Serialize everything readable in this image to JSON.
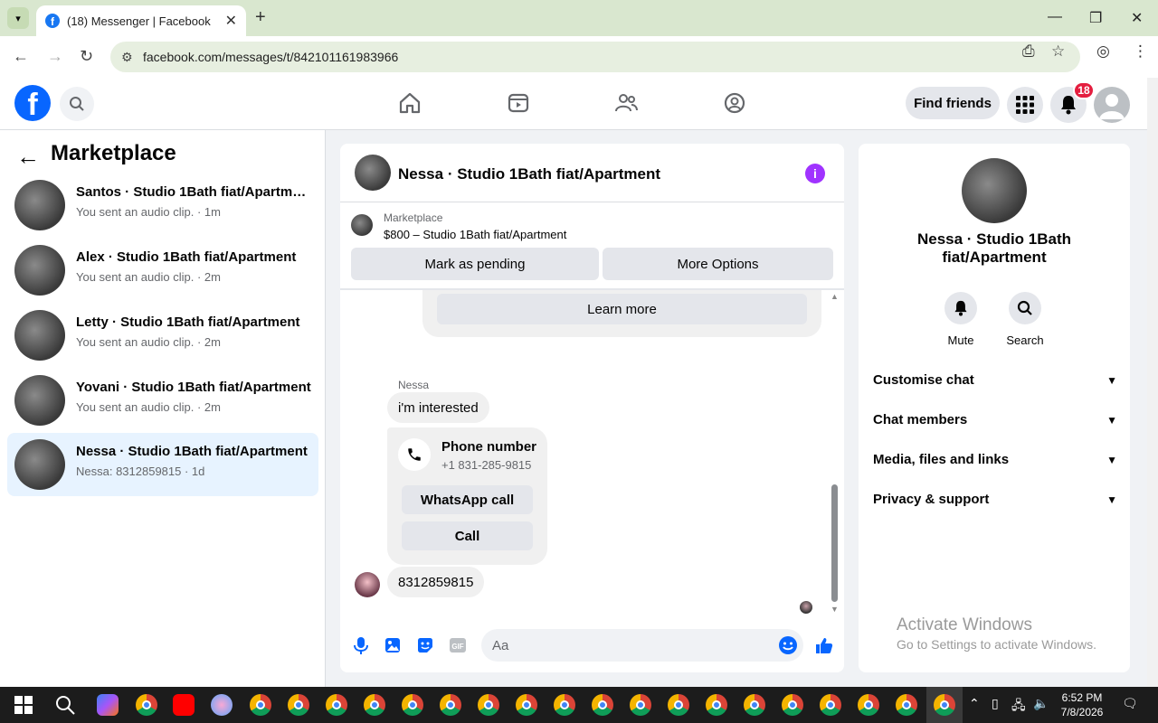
{
  "browser": {
    "tab_title": "(18) Messenger | Facebook",
    "url": "facebook.com/messages/t/842101161983966"
  },
  "header": {
    "find_friends": "Find friends",
    "notification_count": "18"
  },
  "left": {
    "title": "Marketplace",
    "conversations": [
      {
        "name": "Santos · Studio 1Bath fiat/Apartme...",
        "sub": "You sent an audio clip. · 1m"
      },
      {
        "name": "Alex · Studio 1Bath fiat/Apartment",
        "sub": "You sent an audio clip. · 2m"
      },
      {
        "name": "Letty · Studio 1Bath fiat/Apartment",
        "sub": "You sent an audio clip. · 2m"
      },
      {
        "name": "Yovani · Studio 1Bath fiat/Apartment",
        "sub": "You sent an audio clip. · 2m"
      },
      {
        "name": "Nessa · Studio 1Bath fiat/Apartment",
        "sub": "Nessa: 8312859815 · 1d"
      }
    ]
  },
  "chat": {
    "title": "Nessa · Studio 1Bath fiat/Apartment",
    "marketplace_label": "Marketplace",
    "listing": "$800 – Studio 1Bath fiat/Apartment",
    "mark_pending": "Mark as pending",
    "more_options": "More Options",
    "learn_more": "Learn more",
    "sender": "Nessa",
    "msg1": "i'm interested",
    "phone_title": "Phone number",
    "phone_number": "+1 831-285-9815",
    "whatsapp_call": "WhatsApp call",
    "call": "Call",
    "msg2": "8312859815",
    "composer_placeholder": "Aa"
  },
  "right": {
    "name": "Nessa · Studio 1Bath fiat/Apartment",
    "mute": "Mute",
    "search": "Search",
    "rows": [
      "Customise chat",
      "Chat members",
      "Media, files and links",
      "Privacy & support"
    ]
  },
  "watermark": {
    "line1": "Activate Windows",
    "line2": "Go to Settings to activate Windows."
  },
  "taskbar": {
    "time": "6:52 PM",
    "date": "7/8/2026"
  }
}
